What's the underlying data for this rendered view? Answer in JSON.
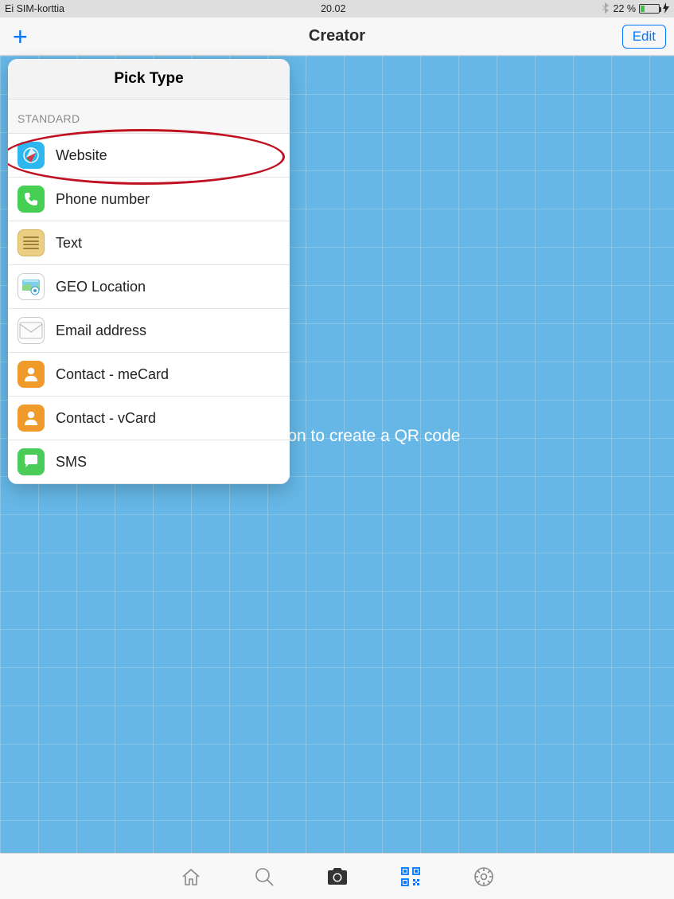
{
  "status": {
    "carrier": "Ei SIM-korttia",
    "time": "20.02",
    "battery_text": "22 %"
  },
  "nav": {
    "title": "Creator",
    "edit_label": "Edit"
  },
  "content": {
    "placeholder": "Tap + button to create a QR code"
  },
  "popover": {
    "title": "Pick Type",
    "section_label": "STANDARD",
    "items": [
      {
        "label": "Website"
      },
      {
        "label": "Phone number"
      },
      {
        "label": "Text"
      },
      {
        "label": "GEO Location"
      },
      {
        "label": "Email address"
      },
      {
        "label": "Contact - meCard"
      },
      {
        "label": "Contact - vCard"
      },
      {
        "label": "SMS"
      }
    ]
  }
}
